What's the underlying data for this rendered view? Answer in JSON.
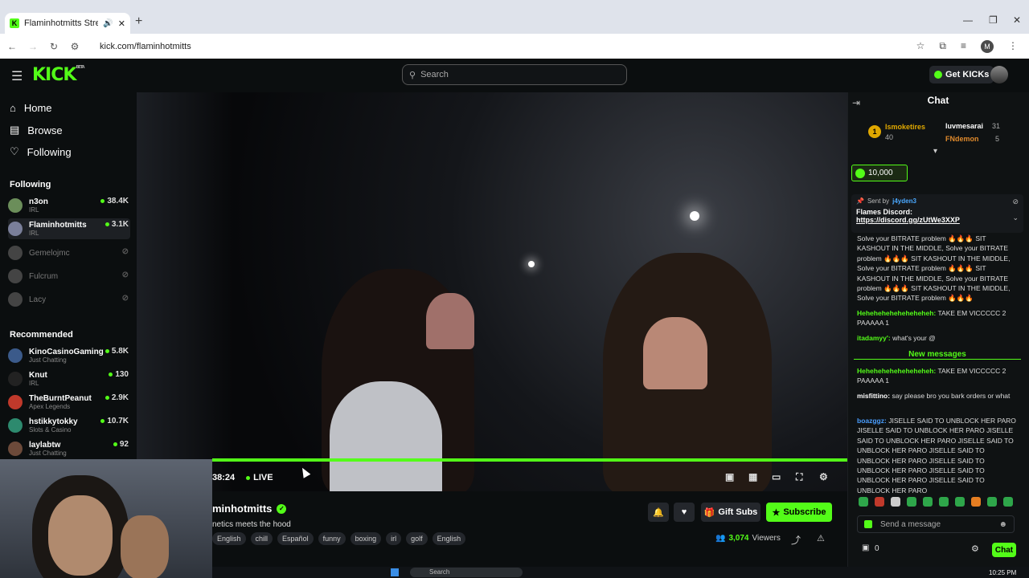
{
  "browser": {
    "tab_title": "Flaminhotmitts Stream - W",
    "url": "kick.com/flaminhotmitts",
    "profile_initial": "M"
  },
  "header": {
    "logo": "KICK",
    "logo_badge": "BETA",
    "search_placeholder": "Search",
    "get_kicks_label": "Get KICKs"
  },
  "sidebar": {
    "nav": [
      {
        "label": "Home"
      },
      {
        "label": "Browse"
      },
      {
        "label": "Following"
      }
    ],
    "following_title": "Following",
    "following": [
      {
        "name": "n3on",
        "category": "IRL",
        "viewers": "38.4K"
      },
      {
        "name": "Flaminhotmitts",
        "category": "IRL",
        "viewers": "3.1K"
      },
      {
        "name": "Gemelojmc",
        "category": "",
        "viewers": ""
      },
      {
        "name": "Fulcrum",
        "category": "",
        "viewers": ""
      },
      {
        "name": "Lacy",
        "category": "",
        "viewers": ""
      }
    ],
    "recommended_title": "Recommended",
    "recommended": [
      {
        "name": "KinoCasinoGaming",
        "category": "Just Chatting",
        "viewers": "5.8K"
      },
      {
        "name": "Knut",
        "category": "IRL",
        "viewers": "130"
      },
      {
        "name": "TheBurntPeanut",
        "category": "Apex Legends",
        "viewers": "2.9K"
      },
      {
        "name": "hstikkytokky",
        "category": "Slots & Casino",
        "viewers": "10.7K"
      },
      {
        "name": "laylabtw",
        "category": "Just Chatting",
        "viewers": "92"
      }
    ]
  },
  "player": {
    "time": "38:24",
    "live_label": "LIVE"
  },
  "stream": {
    "title": "minhotmitts",
    "subtitle": "netics meets the hood",
    "tags": [
      "English",
      "chill",
      "Español",
      "funny",
      "boxing",
      "irl",
      "golf",
      "English"
    ],
    "gift_subs_label": "Gift Subs",
    "subscribe_label": "Subscribe",
    "viewers_count": "3,074",
    "viewers_label": "Viewers"
  },
  "chat": {
    "title": "Chat",
    "leaderboard": [
      {
        "name": "Ismoketires",
        "count": "40",
        "rank": "1"
      },
      {
        "name": "luvmesarai",
        "count": "31"
      },
      {
        "name": "FNdemon",
        "count": "5"
      }
    ],
    "goal_amount": "10,000",
    "pinned_sent_by": "Sent by",
    "pinned_user": "j4yden3",
    "pinned_text": "Flames Discord:",
    "pinned_link": "https://discord.gg/zUtWe3XXP",
    "messages": [
      {
        "user": "",
        "text": "Solve your BITRATE problem 🔥🔥🔥 SIT KASHOUT IN THE MIDDLE, Solve your BITRATE problem 🔥🔥🔥 SIT KASHOUT IN THE MIDDLE, Solve your BITRATE problem 🔥🔥🔥 SIT KASHOUT IN THE MIDDLE, Solve your BITRATE problem 🔥🔥🔥 SIT KASHOUT IN THE MIDDLE, Solve your BITRATE problem 🔥🔥🔥",
        "color": "#53fc18"
      },
      {
        "user": "Heheheheheheheheheh:",
        "text": "TAKE EM VICCCCC 2 PAAAAA 1",
        "color": "#53fc18"
      },
      {
        "user": "itadamyy':",
        "text": "what's your @",
        "color": "#53fc18"
      },
      {
        "user": "Heheheheheheheheheh:",
        "text": "TAKE EM VICCCCC 2 PAAAAA 1",
        "color": "#53fc18"
      },
      {
        "user": "misfittino:",
        "text": "say please bro you bark orders or what",
        "color": "#ffffff"
      },
      {
        "user": "boazggz:",
        "text": "JISELLE SAID TO UNBLOCK HER PARO JISELLE SAID TO UNBLOCK HER PARO JISELLE SAID TO UNBLOCK HER PARO JISELLE SAID TO UNBLOCK HER PARO JISELLE SAID TO UNBLOCK HER PARO JISELLE SAID TO UNBLOCK HER PARO JISELLE SAID TO UNBLOCK HER PARO JISELLE SAID TO UNBLOCK HER PARO",
        "color": "#4a9eff"
      }
    ],
    "new_messages_label": "New messages",
    "send_placeholder": "Send a message",
    "kicks_count": "0",
    "chat_button": "Chat"
  },
  "taskbar": {
    "search_label": "Search",
    "clock": "10:25 PM"
  }
}
